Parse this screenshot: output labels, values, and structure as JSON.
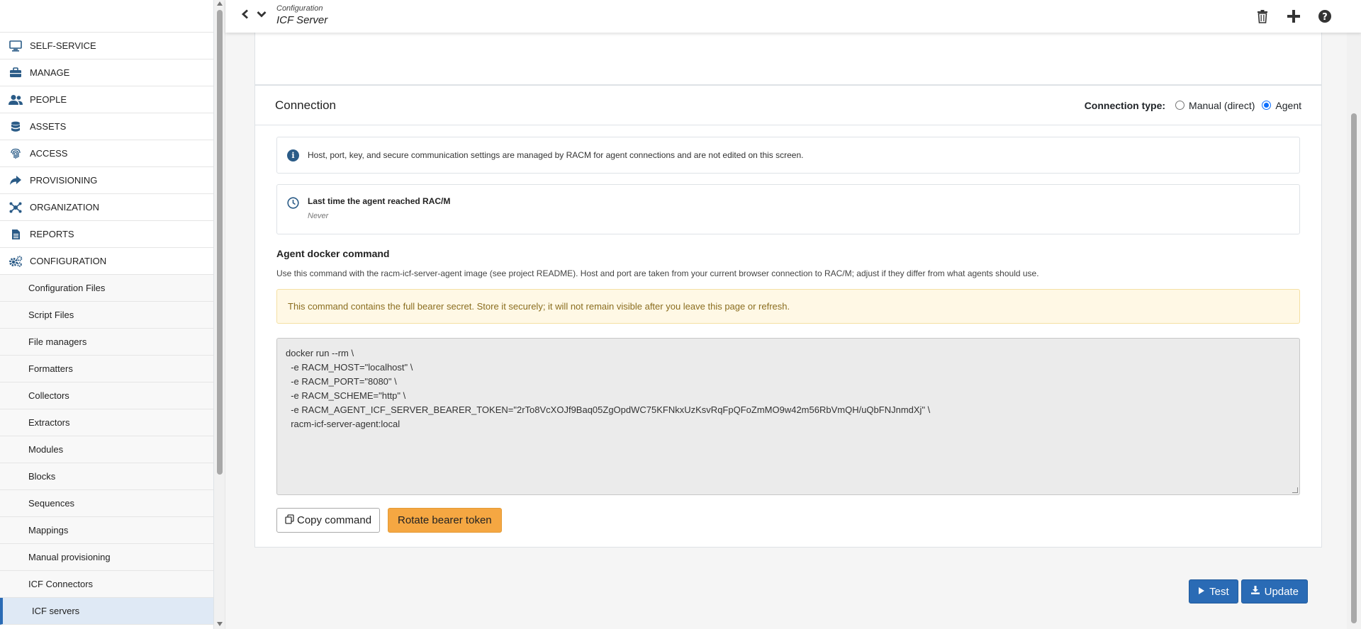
{
  "header": {
    "breadcrumb_parent": "Configuration",
    "title": "ICF Server"
  },
  "sidebar": {
    "items": [
      {
        "label": "SELF-SERVICE",
        "icon": "monitor-icon"
      },
      {
        "label": "MANAGE",
        "icon": "briefcase-icon"
      },
      {
        "label": "PEOPLE",
        "icon": "users-icon"
      },
      {
        "label": "ASSETS",
        "icon": "database-icon"
      },
      {
        "label": "ACCESS",
        "icon": "fingerprint-icon"
      },
      {
        "label": "PROVISIONING",
        "icon": "share-icon"
      },
      {
        "label": "ORGANIZATION",
        "icon": "network-icon"
      },
      {
        "label": "REPORTS",
        "icon": "file-icon"
      },
      {
        "label": "CONFIGURATION",
        "icon": "gears-icon"
      }
    ],
    "sub_items": [
      "Configuration Files",
      "Script Files",
      "File managers",
      "Formatters",
      "Collectors",
      "Extractors",
      "Modules",
      "Blocks",
      "Sequences",
      "Mappings",
      "Manual provisioning",
      "ICF Connectors",
      "ICF servers"
    ],
    "active_sub": "ICF servers"
  },
  "connection": {
    "title": "Connection",
    "type_label": "Connection type:",
    "options": [
      "Manual (direct)",
      "Agent"
    ],
    "selected": "Agent",
    "info_text": "Host, port, key, and secure communication settings are managed by RACM for agent connections and are not edited on this screen.",
    "last_reached_label": "Last time the agent reached RAC/M",
    "last_reached_value": "Never",
    "docker_title": "Agent docker command",
    "docker_desc": "Use this command with the racm-icf-server-agent image (see project README). Host and port are taken from your current browser connection to RAC/M; adjust if they differ from what agents should use.",
    "warning": "This command contains the full bearer secret. Store it securely; it will not remain visible after you leave this page or refresh.",
    "command": "docker run --rm \\\n  -e RACM_HOST=\"localhost\" \\\n  -e RACM_PORT=\"8080\" \\\n  -e RACM_SCHEME=\"http\" \\\n  -e RACM_AGENT_ICF_SERVER_BEARER_TOKEN=\"2rTo8VcXOJf9Baq05ZgOpdWC75KFNkxUzKsvRqFpQFoZmMO9w42m56RbVmQH/uQbFNJnmdXj\" \\\n  racm-icf-server-agent:local",
    "copy_label": "Copy command",
    "rotate_label": "Rotate bearer token"
  },
  "footer": {
    "test_label": "Test",
    "update_label": "Update"
  },
  "colors": {
    "primary": "#2a6bb5",
    "warning_button": "#f5a742",
    "icon_blue": "#2a5b87"
  }
}
